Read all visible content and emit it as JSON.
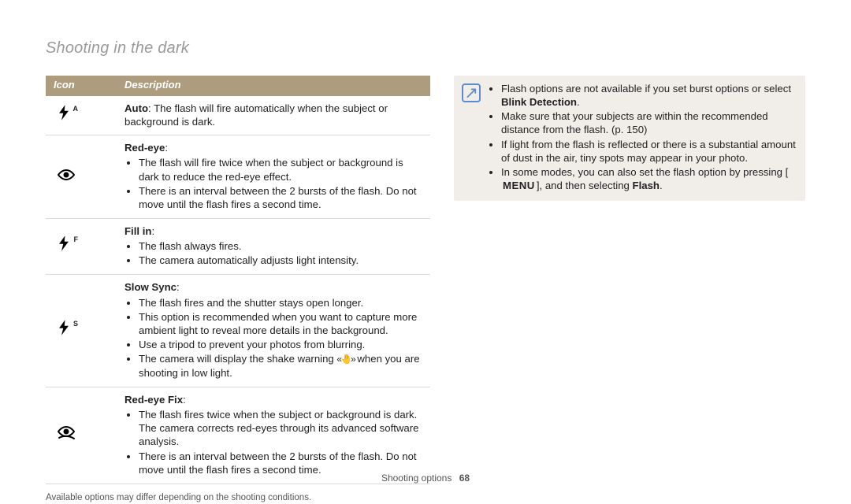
{
  "page_title": "Shooting in the dark",
  "table": {
    "headers": {
      "icon": "Icon",
      "desc": "Description"
    },
    "rows": [
      {
        "icon": {
          "kind": "flash",
          "letter": "A"
        },
        "title": "Auto",
        "inline_after_title": ": The flash will fire automatically when the subject or background is dark.",
        "bullets": []
      },
      {
        "icon": {
          "kind": "eye"
        },
        "title": "Red-eye",
        "inline_after_title": ":",
        "bullets": [
          "The flash will fire twice when the subject or background is dark to reduce the red-eye effect.",
          "There is an interval between the 2 bursts of the flash. Do not move until the flash fires a second time."
        ]
      },
      {
        "icon": {
          "kind": "flash",
          "letter": "F"
        },
        "title": "Fill in",
        "inline_after_title": ":",
        "bullets": [
          "The flash always fires.",
          "The camera automatically adjusts light intensity."
        ]
      },
      {
        "icon": {
          "kind": "flash",
          "letter": "S"
        },
        "title": "Slow Sync",
        "inline_after_title": ":",
        "bullets": [
          "The flash fires and the shutter stays open longer.",
          "This option is recommended when you want to capture more ambient light to reveal more details in the background.",
          "Use a tripod to prevent your photos from blurring.",
          "__SHAKE__"
        ],
        "shake_prefix": "The camera will display the shake warning ",
        "shake_suffix": " when you are shooting in low light."
      },
      {
        "icon": {
          "kind": "eye-slash"
        },
        "title": "Red-eye Fix",
        "inline_after_title": ":",
        "bullets": [
          "The flash fires twice when the subject or background is dark. The camera corrects red-eyes through its advanced software analysis.",
          "There is an interval between the 2 bursts of the flash. Do not move until the flash fires a second time."
        ]
      }
    ]
  },
  "under_note": "Available options may differ depending on the shooting conditions.",
  "notes": {
    "items": [
      {
        "pre": "Flash options are not available if you set burst options or select ",
        "bold": "Blink Detection",
        "post": "."
      },
      {
        "pre": "Make sure that your subjects are within the recommended distance from the flash. (p. 150)"
      },
      {
        "pre": "If light from the flash is reflected or there is a substantial amount of dust in the air, tiny spots may appear in your photo."
      },
      {
        "pre": "In some modes, you can also set the flash option by pressing [",
        "menu": "MENU",
        "mid": "], and then selecting ",
        "bold": "Flash",
        "post": "."
      }
    ]
  },
  "footer": {
    "section": "Shooting options",
    "page": "68"
  }
}
